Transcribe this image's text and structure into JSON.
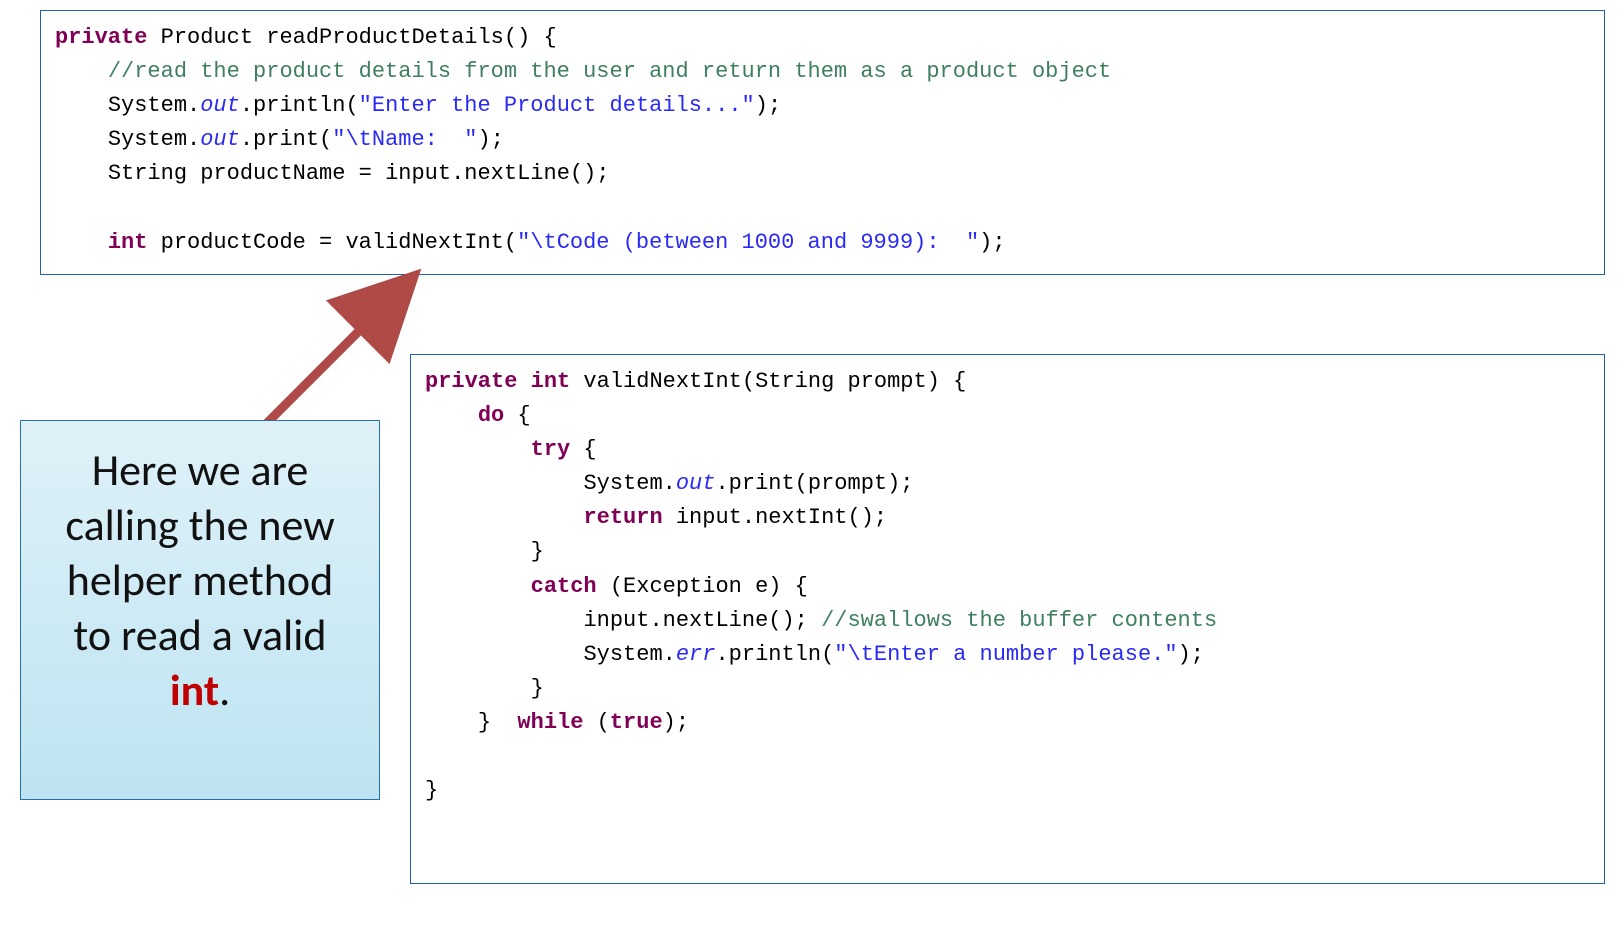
{
  "callout": {
    "line1": "Here we are",
    "line2": "calling the new",
    "line3": "helper method",
    "line4": "to read a valid",
    "accent": "int",
    "period": "."
  },
  "code_top": {
    "t": {
      "private": "private",
      "product_type": "Product",
      "method_name": "readProductDetails",
      "open": "() {",
      "comment": "//read the product details from the user and return them as a product object",
      "sys": "System.",
      "out": "out",
      "println": ".println(",
      "str1": "\"Enter the Product details...\"",
      "print": ".print(",
      "str2": "\"\\tName:  \"",
      "close_stmt": ");",
      "string_type": "String",
      "pname_decl": " productName = input.nextLine();",
      "int_kw": "int",
      "pcode_decl": " productCode = validNextInt(",
      "str3": "\"\\tCode (between 1000 and 9999):  \"",
      "close_stmt2": ");"
    }
  },
  "code_bottom": {
    "t": {
      "private": "private",
      "int_kw": "int",
      "method_name": " validNextInt(String prompt) {",
      "do_kw": "do",
      "try_kw": "try",
      "brace_open": " {",
      "sys": "System.",
      "out": "out",
      "print_prompt": ".print(prompt);",
      "return_kw": "return",
      "return_rest": " input.nextInt();",
      "brace_close": "}",
      "catch_kw": "catch",
      "catch_rest": " (Exception e) {",
      "swallow_call": "input.nextLine(); ",
      "swallow_cmt": "//swallows the buffer contents",
      "err": "err",
      "err_println": ".println(",
      "err_str": "\"\\tEnter a number please.\"",
      "close_stmt": ");",
      "while_kw": "while",
      "while_rest": " (",
      "true_kw": "true",
      "while_close": ");"
    }
  }
}
